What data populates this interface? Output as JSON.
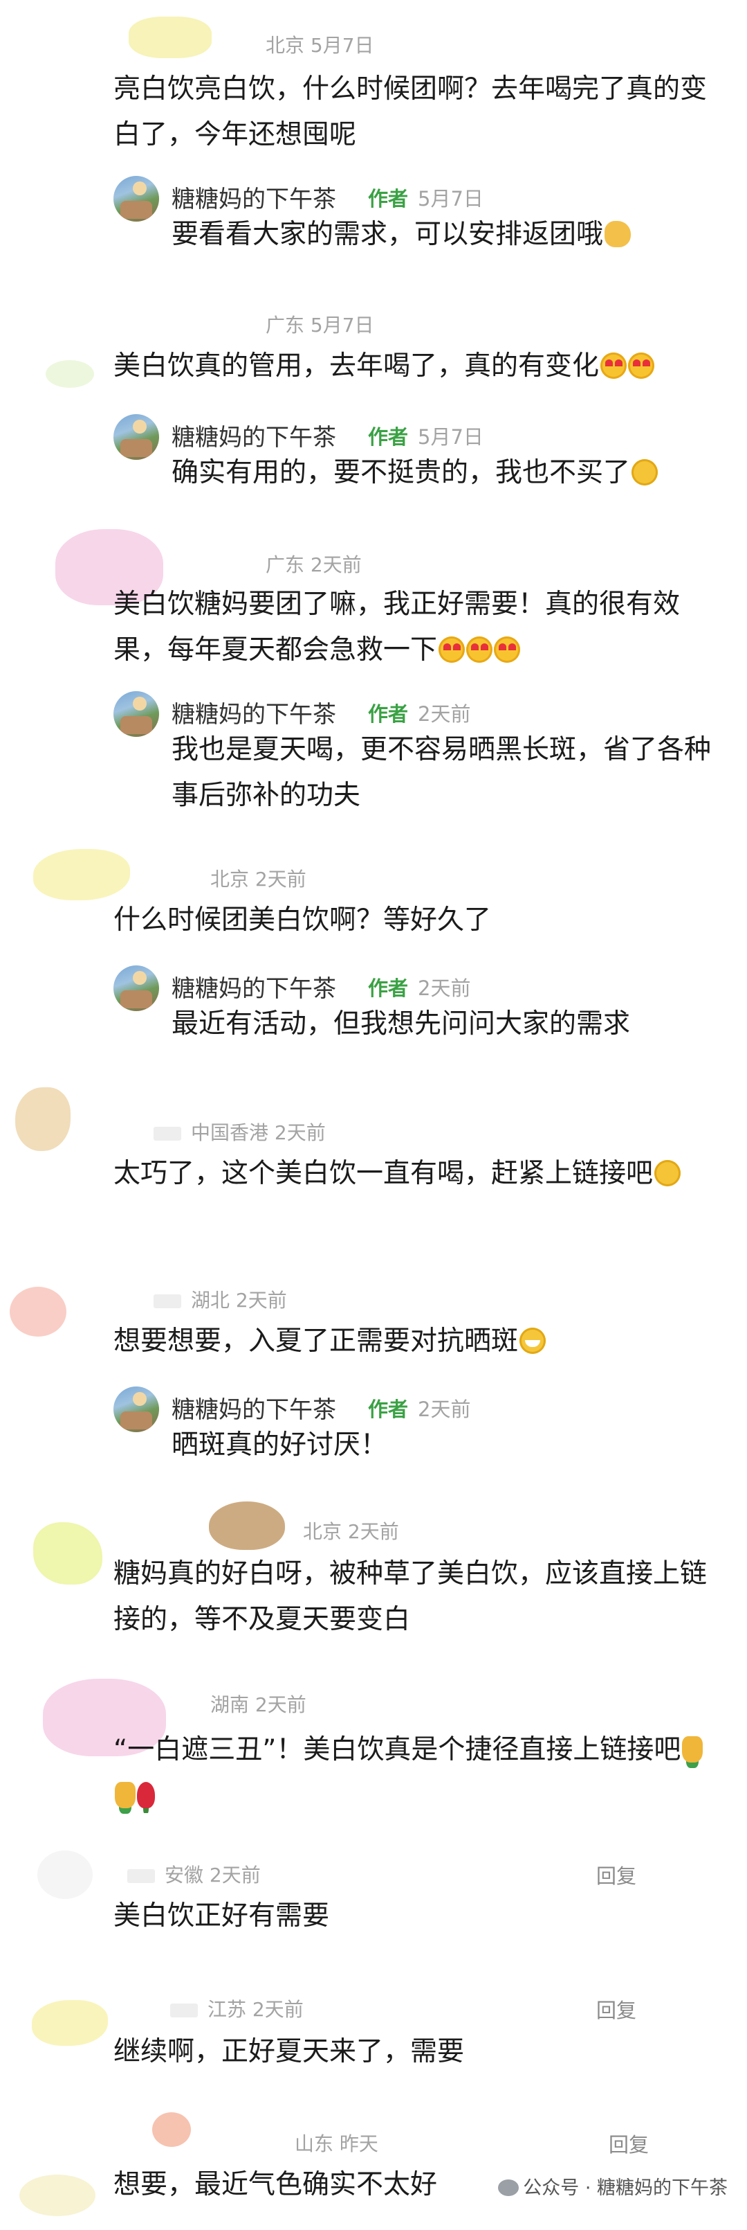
{
  "reply_author": "糖糖妈的下午茶",
  "author_badge": "作者",
  "reply_label": "回复",
  "comments": [
    {
      "location_time": "北京 5月7日",
      "text": "亮白饮亮白饮，什么时候团啊？去年喝完了真的变白了，今年还想囤呢",
      "reply": {
        "time": "5月7日",
        "text": "要看看大家的需求，可以安排返团哦"
      }
    },
    {
      "location_time": "广东 5月7日",
      "text": "美白饮真的管用，去年喝了，真的有变化",
      "reply": {
        "time": "5月7日",
        "text": "确实有用的，要不挺贵的，我也不买了"
      }
    },
    {
      "location_time": "广东 2天前",
      "text": "美白饮糖妈要团了嘛，我正好需要！真的很有效果，每年夏天都会急救一下",
      "reply": {
        "time": "2天前",
        "text": "我也是夏天喝，更不容易晒黑长斑，省了各种事后弥补的功夫"
      }
    },
    {
      "location_time": "北京 2天前",
      "text": "什么时候团美白饮啊？等好久了",
      "reply": {
        "time": "2天前",
        "text": "最近有活动，但我想先问问大家的需求"
      }
    },
    {
      "location_time": "中国香港 2天前",
      "text": "太巧了，这个美白饮一直有喝，赶紧上链接吧"
    },
    {
      "location_time": "湖北 2天前",
      "text": "想要想要，入夏了正需要对抗晒斑",
      "reply": {
        "time": "2天前",
        "text": "晒斑真的好讨厌！"
      }
    },
    {
      "location_time": "北京 2天前",
      "text": "糖妈真的好白呀，被种草了美白饮，应该直接上链接的，等不及夏天要变白"
    },
    {
      "location_time": "湖南 2天前",
      "text": "“一白遮三丑”！美白饮真是个捷径直接上链接吧"
    },
    {
      "location_time": "安徽 2天前",
      "text": "美白饮正好有需要",
      "show_reply": true
    },
    {
      "location_time": "江苏 2天前",
      "text": "继续啊，正好夏天来了，需要",
      "show_reply": true
    },
    {
      "location_time": "山东 昨天",
      "text": "想要，最近气色确实不太好",
      "show_reply": true
    }
  ],
  "footer": "公众号 · 糖糖妈的下午茶"
}
